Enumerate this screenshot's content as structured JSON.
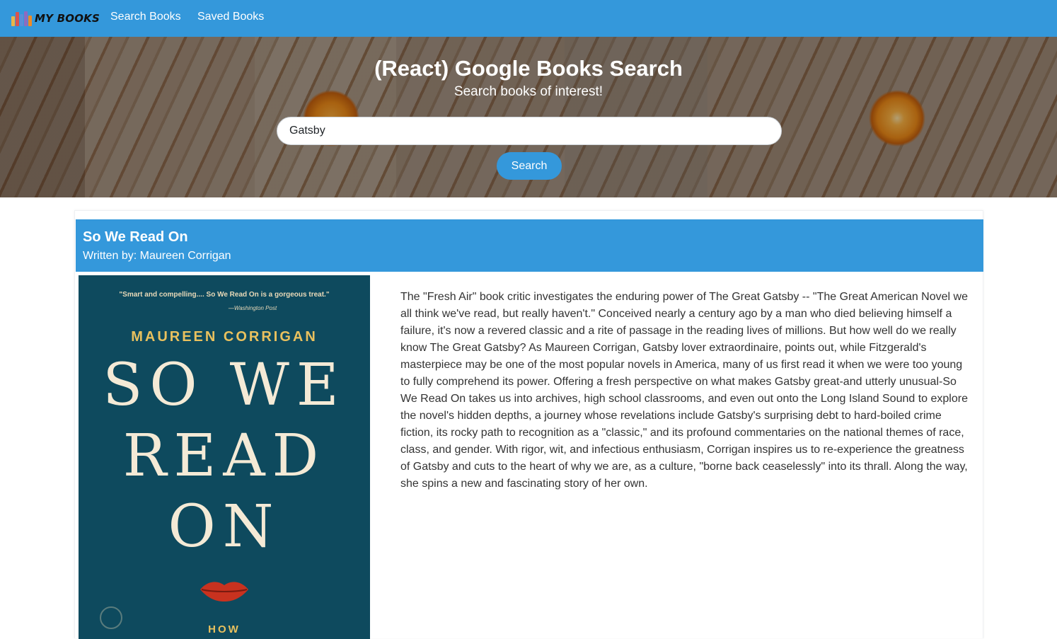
{
  "navbar": {
    "brand_text": "MY BOOKS",
    "brand_icon": "books-icon",
    "links": [
      "Search Books",
      "Saved Books"
    ],
    "background": "#3498db"
  },
  "hero": {
    "title": "(React) Google Books Search",
    "subtitle": "Search books of interest!",
    "search": {
      "value": "Gatsby"
    },
    "search_button_label": "Search"
  },
  "result": {
    "title": "So We Read On",
    "author_prefix": "Written by: ",
    "author": "Maureen Corrigan",
    "cover": {
      "quote": "\"Smart and compelling.... So We Read On is a gorgeous treat.\"",
      "quote_source": "—Washington Post",
      "author": "MAUREEN CORRIGAN",
      "line1": "SO WE",
      "line2": "READ",
      "line3": "ON",
      "bottom": "HOW",
      "background": "#0e4a5e"
    },
    "description": "The \"Fresh Air\" book critic investigates the enduring power of The Great Gatsby -- \"The Great American Novel we all think we've read, but really haven't.\" Conceived nearly a century ago by a man who died believing himself a failure, it's now a revered classic and a rite of passage in the reading lives of millions. But how well do we really know The Great Gatsby? As Maureen Corrigan, Gatsby lover extraordinaire, points out, while Fitzgerald's masterpiece may be one of the most popular novels in America, many of us first read it when we were too young to fully comprehend its power. Offering a fresh perspective on what makes Gatsby great-and utterly unusual-So We Read On takes us into archives, high school classrooms, and even out onto the Long Island Sound to explore the novel's hidden depths, a journey whose revelations include Gatsby's surprising debt to hard-boiled crime fiction, its rocky path to recognition as a \"classic,\" and its profound commentaries on the national themes of race, class, and gender. With rigor, wit, and infectious enthusiasm, Corrigan inspires us to re-experience the greatness of Gatsby and cuts to the heart of why we are, as a culture, \"borne back ceaselessly\" into its thrall. Along the way, she spins a new and fascinating story of her own."
  }
}
